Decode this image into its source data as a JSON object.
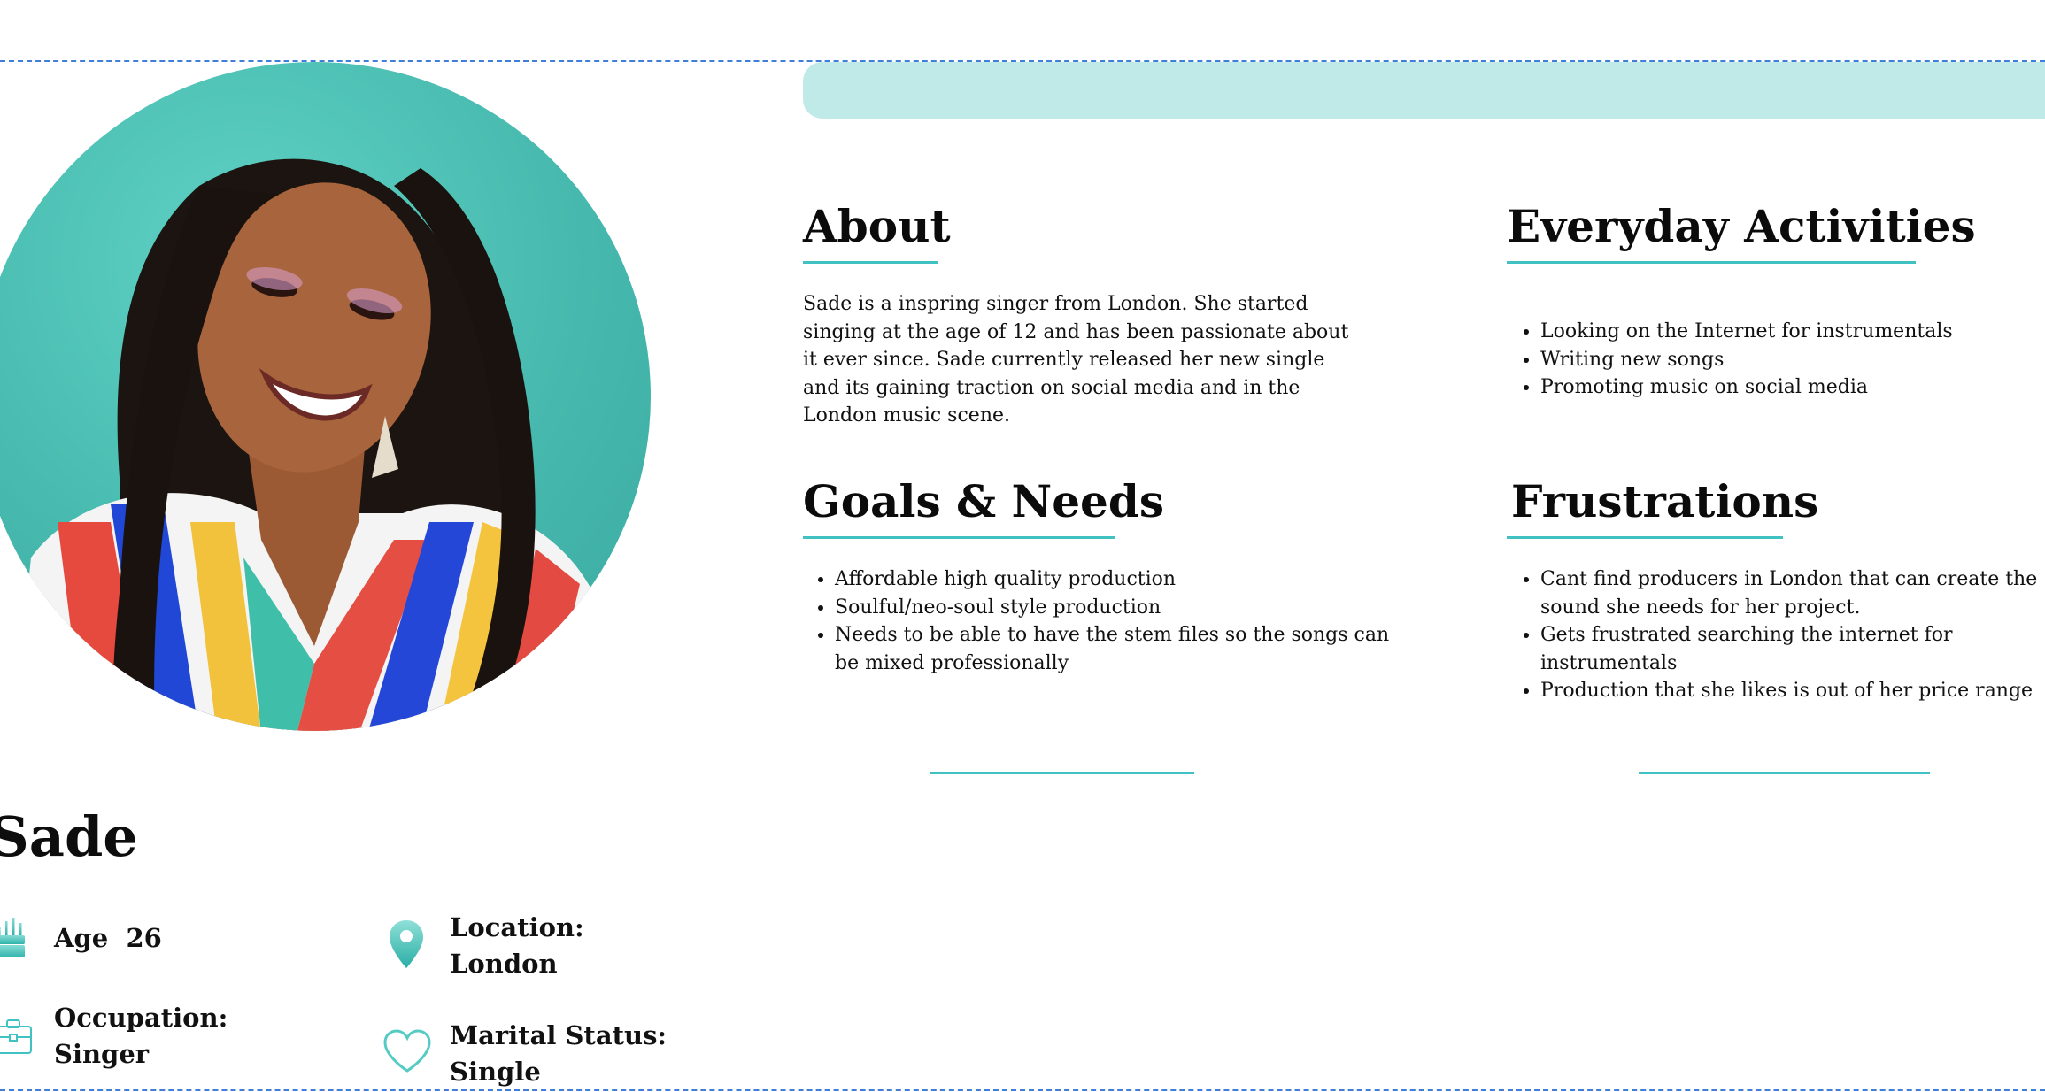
{
  "persona": {
    "name": "Sade",
    "photo_alt": "portrait photo"
  },
  "about": {
    "title": "About",
    "text": "Sade is a inspring singer from London. She started singing at the age of 12 and has been passionate about it ever since. Sade currently released her new single and its gaining traction on social media and in the London music scene."
  },
  "everyday": {
    "title": "Everyday Activities",
    "items": [
      "Looking on the Internet for instrumentals",
      "Writing new songs",
      "Promoting music on social media"
    ]
  },
  "goals": {
    "title": "Goals & Needs",
    "items": [
      "Affordable high quality production",
      "Soulful/neo-soul style production",
      "Needs to be able to have the stem files so the songs can be mixed professionally"
    ]
  },
  "frustrations": {
    "title": "Frustrations",
    "items": [
      "Cant find producers in London that can create the sound she needs for her project.",
      "Gets frustrated searching the internet for instrumentals",
      "Production that she likes is out of her price range"
    ]
  },
  "facts": {
    "age_label": "Age",
    "age_value": "26",
    "location_label": "Location:",
    "location_value": "London",
    "occupation_label": "Occupation:",
    "occupation_value": "Singer",
    "marital_label": "Marital Status:",
    "marital_value": "Single"
  },
  "icons": {
    "age": "cake-icon",
    "location": "location-pin-icon",
    "occupation": "briefcase-icon",
    "marital": "heart-icon"
  },
  "colors": {
    "accent": "#3fc2c1",
    "bar": "#bfeae7",
    "portrait_bg": "#46b8ad"
  }
}
